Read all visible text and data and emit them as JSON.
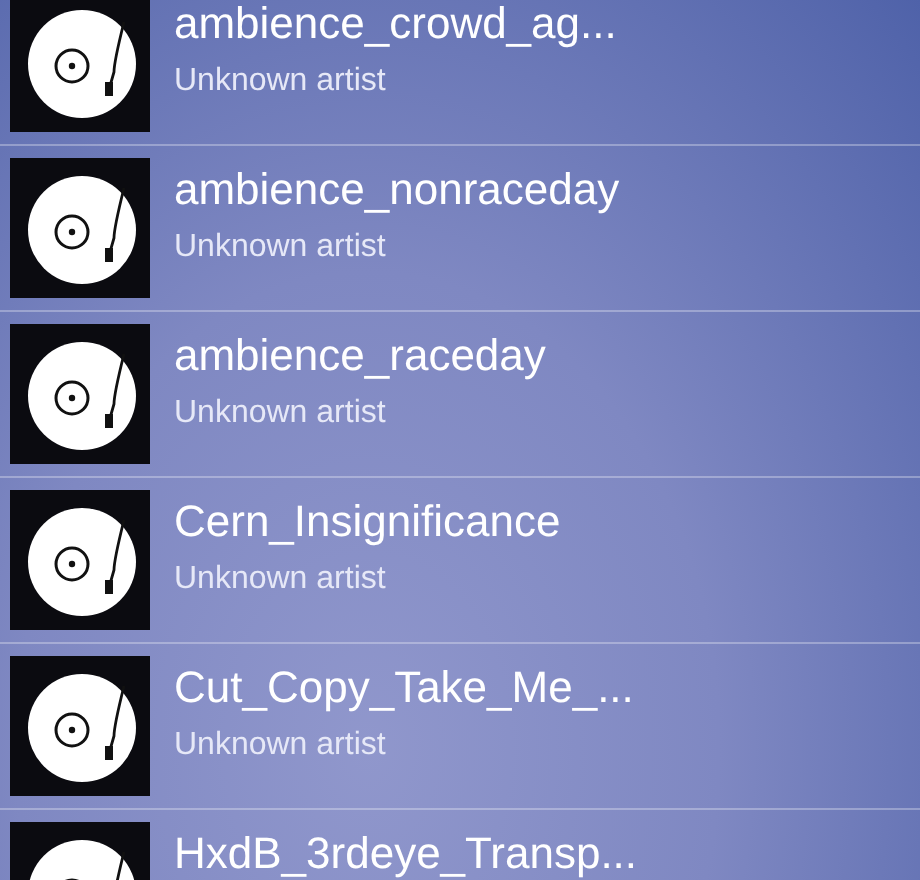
{
  "tracks": [
    {
      "title": "ambience_crowd_ag...",
      "artist": "Unknown artist"
    },
    {
      "title": "ambience_nonraceday",
      "artist": "Unknown artist"
    },
    {
      "title": "ambience_raceday",
      "artist": "Unknown artist"
    },
    {
      "title": "Cern_Insignificance",
      "artist": "Unknown artist"
    },
    {
      "title": "Cut_Copy_Take_Me_...",
      "artist": "Unknown artist"
    },
    {
      "title": "HxdB_3rdeye_Transp..."
    }
  ]
}
